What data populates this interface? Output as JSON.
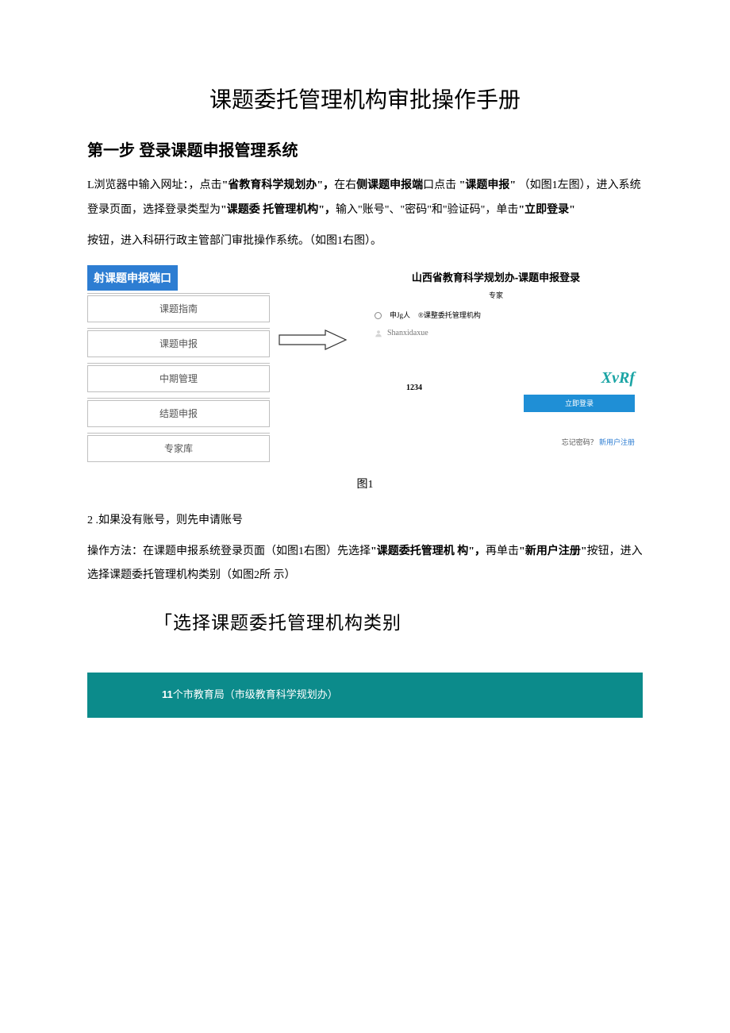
{
  "title": "课题委托管理机构审批操作手册",
  "step_heading": "第一步 登录课题申报管理系统",
  "para1_a": "L浏览器中输入网址：，点击",
  "para1_b": "\"省教育科学规划办\"，",
  "para1_c": "在右",
  "para1_d": "侧课题申报端",
  "para1_e": "口点击 ",
  "para1_f": "\"课题申报\"",
  "para1_g": " （如图1左图），进入系统登录页面，选择登录类型为",
  "para1_h": "\"课题委 托管理机构\"，",
  "para1_i": "输入\"账号\"、\"密码\"和\"验证码\"，单击",
  "para1_j": "\"立即登录\"",
  "para2": "按钮，进入科研行政主管部门审批操作系统。（如图1右图）。",
  "badge": "射课题申报端口",
  "menu": [
    "课题指南",
    "课题申报",
    "中期管理",
    "结题申报",
    "专家库"
  ],
  "login": {
    "title": "山西省教育科学规划办-课题申报登录",
    "sub": "专家",
    "r1": "申Jg人",
    "r2": "®课整委托管理机构",
    "username": "Shanxidaxue",
    "code": "1234",
    "captcha": "XvRf",
    "btn": "立即登录",
    "forgot": "忘记密码？",
    "register": "新用户注册"
  },
  "fig1": "图1",
  "para3_a": "2 .如果没有账号，则先申请账号",
  "para4_a": "操作方法：在课题申报系统登录页面（如图1右图）先选择",
  "para4_b": "\"课题委托管理机 构\"，",
  "para4_c": "再单击",
  "para4_d": "\"新用户注册\"",
  "para4_e": "按钮，进入选择课题委托管理机构类别（如图2所 示）",
  "sub_heading": "「选择课题委托管理机构类别",
  "teal_a": "11",
  "teal_b": "个市教育局（市级教育科学规划办）"
}
